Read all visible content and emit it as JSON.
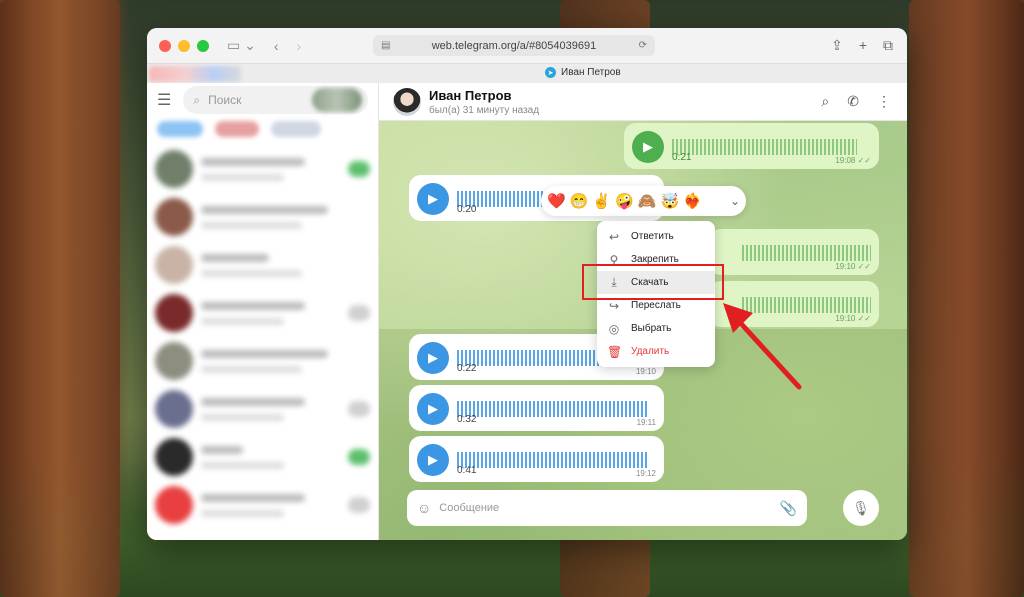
{
  "browser": {
    "url": "web.telegram.org/a/#8054039691",
    "tab_title": "Иван Петров"
  },
  "sidebar": {
    "search_placeholder": "Поиск"
  },
  "chat": {
    "name": "Иван Петров",
    "status": "был(а) 31 минуту назад"
  },
  "messages": [
    {
      "id": "m1",
      "dir": "out",
      "duration": "0:21",
      "time": "19:08",
      "read": true
    },
    {
      "id": "m2",
      "dir": "in",
      "duration": "0:20",
      "time": ""
    },
    {
      "id": "m3",
      "dir": "out",
      "duration": "",
      "time": "19:10",
      "read": true
    },
    {
      "id": "m4",
      "dir": "out",
      "duration": "",
      "time": "19:10",
      "read": true
    },
    {
      "id": "m5",
      "dir": "in",
      "duration": "0:22",
      "time": "19:10"
    },
    {
      "id": "m6",
      "dir": "in",
      "duration": "0:32",
      "time": "19:11"
    },
    {
      "id": "m7",
      "dir": "in",
      "duration": "0:41",
      "time": "19:12"
    }
  ],
  "reactions": [
    "❤️",
    "😁",
    "✌️",
    "🤪",
    "🙈",
    "🤯",
    "❤️‍🔥"
  ],
  "context_menu": {
    "reply": "Ответить",
    "pin": "Закрепить",
    "download": "Скачать",
    "forward": "Переслать",
    "select": "Выбрать",
    "delete": "Удалить"
  },
  "composer": {
    "placeholder": "Сообщение"
  },
  "colors": {
    "telegram_blue": "#3b97e3",
    "outgoing_bubble": "#e0f5c6",
    "highlight_red": "#e02020",
    "delete_red": "#e53935"
  }
}
